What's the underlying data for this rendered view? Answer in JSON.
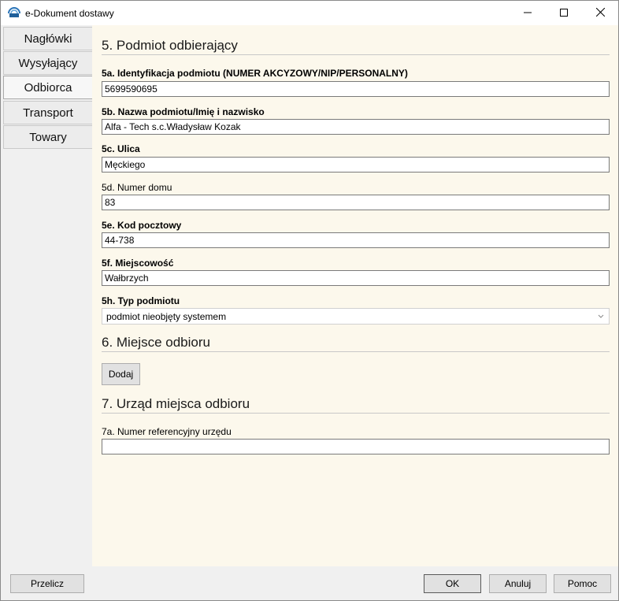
{
  "window": {
    "title": "e-Dokument dostawy"
  },
  "tabs": [
    {
      "label": "Nagłówki"
    },
    {
      "label": "Wysyłający"
    },
    {
      "label": "Odbiorca"
    },
    {
      "label": "Transport"
    },
    {
      "label": "Towary"
    }
  ],
  "section5": {
    "title": "5. Podmiot odbierający",
    "fields": {
      "id": {
        "label": "5a. Identyfikacja podmiotu (NUMER AKCYZOWY/NIP/PERSONALNY)",
        "value": "5699590695"
      },
      "name": {
        "label": "5b. Nazwa podmiotu/Imię i nazwisko",
        "value": "Alfa - Tech s.c.Władysław Kozak"
      },
      "street": {
        "label": "5c. Ulica",
        "value": "Męckiego"
      },
      "house": {
        "label": "5d. Numer domu",
        "value": "83"
      },
      "postal": {
        "label": "5e. Kod pocztowy",
        "value": "44-738"
      },
      "city": {
        "label": "5f. Miejscowość",
        "value": "Wałbrzych"
      },
      "type": {
        "label": "5h. Typ podmiotu",
        "value": "podmiot nieobjęty systemem"
      }
    }
  },
  "section6": {
    "title": "6. Miejsce odbioru",
    "add_label": "Dodaj"
  },
  "section7": {
    "title": "7. Urząd miejsca odbioru",
    "fields": {
      "ref": {
        "label": "7a. Numer referencyjny urzędu",
        "value": ""
      }
    }
  },
  "footer": {
    "recalc_label": "Przelicz",
    "ok_label": "OK",
    "cancel_label": "Anuluj",
    "help_label": "Pomoc"
  },
  "icons": {
    "app": "app-logo-icon",
    "minimize": "minimize-icon",
    "maximize": "maximize-icon",
    "close": "close-icon",
    "dropdown": "chevron-down-icon"
  }
}
